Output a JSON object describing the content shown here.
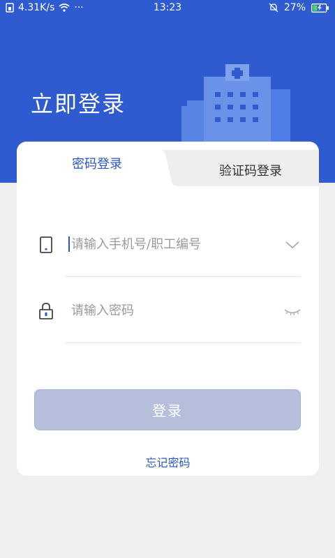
{
  "status_bar": {
    "network_speed": "4.31K/s",
    "more": "···",
    "time": "13:23",
    "battery": "27%"
  },
  "header": {
    "title": "立即登录"
  },
  "tabs": {
    "active": "密码登录",
    "inactive": "验证码登录"
  },
  "form": {
    "account_placeholder": "请输入手机号/职工编号",
    "account_value": "",
    "password_placeholder": "请输入密码",
    "password_value": ""
  },
  "login_button": "登录",
  "forgot_password": "忘记密码",
  "colors": {
    "header": "#2f5bd0",
    "accent": "#2b55c0",
    "button_disabled": "#b5bfdc",
    "page_bg": "#efefef"
  }
}
